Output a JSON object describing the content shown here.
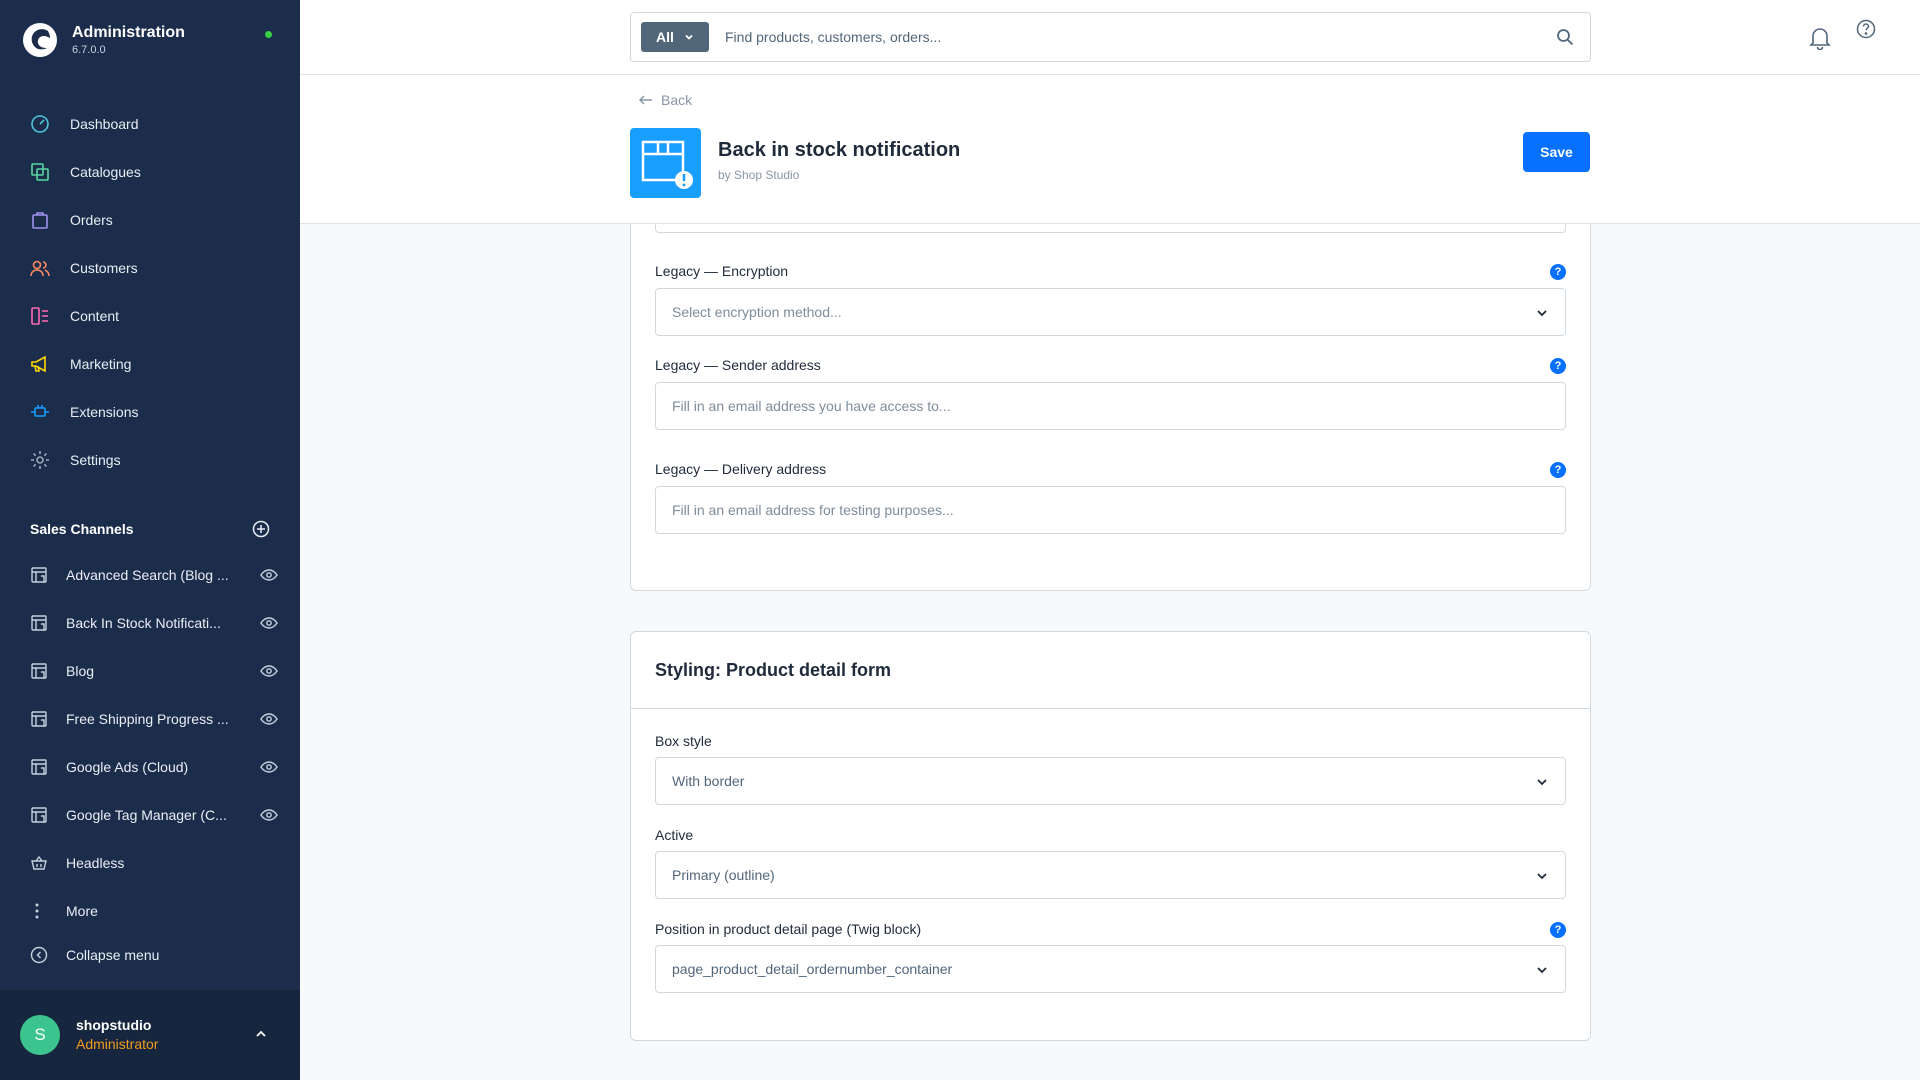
{
  "app": {
    "title": "Administration",
    "version": "6.7.0.0"
  },
  "nav": [
    {
      "label": "Dashboard",
      "icon": "gauge-icon",
      "color": "#4fc3d8"
    },
    {
      "label": "Catalogues",
      "icon": "catalogue-icon",
      "color": "#57d9a3"
    },
    {
      "label": "Orders",
      "icon": "shopping-bag-icon",
      "color": "#a092f0"
    },
    {
      "label": "Customers",
      "icon": "users-icon",
      "color": "#f88962"
    },
    {
      "label": "Content",
      "icon": "content-icon",
      "color": "#ff68b4"
    },
    {
      "label": "Marketing",
      "icon": "megaphone-icon",
      "color": "#ffd700"
    },
    {
      "label": "Extensions",
      "icon": "plug-icon",
      "color": "#189eff"
    },
    {
      "label": "Settings",
      "icon": "gear-icon",
      "color": "#9aa8b5"
    }
  ],
  "sales_channels": {
    "title": "Sales Channels",
    "items": [
      {
        "label": "Advanced Search (Blog ...",
        "visible_icon": true
      },
      {
        "label": "Back In Stock Notificati...",
        "visible_icon": true
      },
      {
        "label": "Blog",
        "visible_icon": true
      },
      {
        "label": "Free Shipping Progress ...",
        "visible_icon": true
      },
      {
        "label": "Google Ads (Cloud)",
        "visible_icon": true
      },
      {
        "label": "Google Tag Manager (C...",
        "visible_icon": true
      },
      {
        "label": "Headless",
        "visible_icon": false
      },
      {
        "label": "More",
        "visible_icon": false
      }
    ]
  },
  "collapse_label": "Collapse menu",
  "user": {
    "initial": "S",
    "name": "shopstudio",
    "role": "Administrator"
  },
  "search": {
    "type_label": "All",
    "placeholder": "Find products, customers, orders..."
  },
  "smartbar": {
    "back_label": "Back",
    "title": "Back in stock notification",
    "by": "by Shop Studio",
    "save_label": "Save"
  },
  "legacy": {
    "encryption": {
      "label": "Legacy — Encryption",
      "placeholder": "Select encryption method..."
    },
    "sender": {
      "label": "Legacy — Sender address",
      "placeholder": "Fill in an email address you have access to..."
    },
    "delivery": {
      "label": "Legacy — Delivery address",
      "placeholder": "Fill in an email address for testing purposes..."
    }
  },
  "styling": {
    "title": "Styling: Product detail form",
    "box_style": {
      "label": "Box style",
      "value": "With border"
    },
    "active": {
      "label": "Active",
      "value": "Primary (outline)"
    },
    "position": {
      "label": "Position in product detail page (Twig block)",
      "value": "page_product_detail_ordernumber_container"
    }
  },
  "colors": {
    "sidebar": "#1b2d4a",
    "primary": "#0870ff",
    "role": "#f39b1c",
    "avatar": "#3cc48f"
  }
}
